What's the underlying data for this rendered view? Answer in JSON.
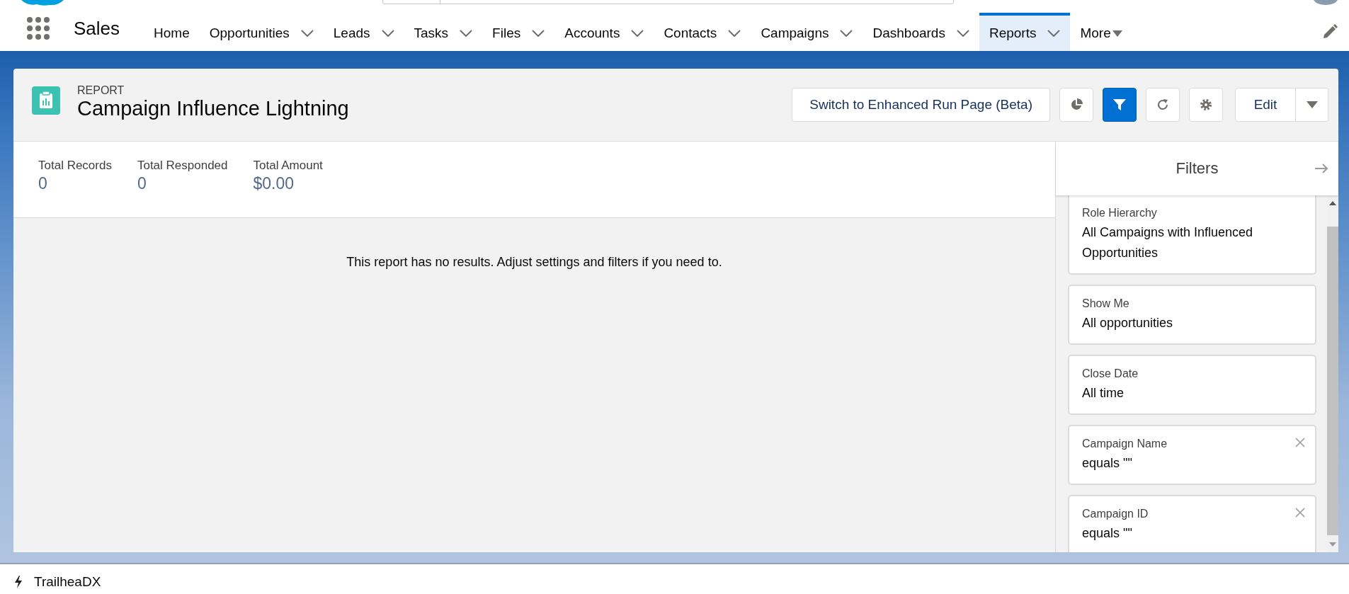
{
  "app_name": "Sales",
  "nav_items": [
    {
      "label": "Home",
      "has_menu": false,
      "selected": false
    },
    {
      "label": "Opportunities",
      "has_menu": true,
      "selected": false
    },
    {
      "label": "Leads",
      "has_menu": true,
      "selected": false
    },
    {
      "label": "Tasks",
      "has_menu": true,
      "selected": false
    },
    {
      "label": "Files",
      "has_menu": true,
      "selected": false
    },
    {
      "label": "Accounts",
      "has_menu": true,
      "selected": false
    },
    {
      "label": "Contacts",
      "has_menu": true,
      "selected": false
    },
    {
      "label": "Campaigns",
      "has_menu": true,
      "selected": false
    },
    {
      "label": "Dashboards",
      "has_menu": true,
      "selected": false
    },
    {
      "label": "Reports",
      "has_menu": true,
      "selected": true
    }
  ],
  "more_menu": {
    "label": "More"
  },
  "report_header": {
    "object_type": "REPORT",
    "title": "Campaign Influence Lightning"
  },
  "actions": {
    "switch_button": "Switch to Enhanced Run Page (Beta)",
    "icon_buttons": [
      {
        "kind": "chart",
        "selected": false
      },
      {
        "kind": "filter",
        "selected": true
      },
      {
        "kind": "refresh",
        "selected": false
      },
      {
        "kind": "settings",
        "selected": false
      }
    ],
    "edit_button": "Edit"
  },
  "stats": [
    {
      "label": "Total Records",
      "value": "0"
    },
    {
      "label": "Total Responded",
      "value": "0"
    },
    {
      "label": "Total Amount",
      "value": "$0.00"
    }
  ],
  "empty_message": "This report has no results. Adjust settings and filters if you need to.",
  "filters_panel": {
    "title": "Filters",
    "items": [
      {
        "label": "Role Hierarchy",
        "value": "All Campaigns with Influenced Opportunities",
        "removable": false
      },
      {
        "label": "Show Me",
        "value": "All opportunities",
        "removable": false
      },
      {
        "label": "Close Date",
        "value": "All time",
        "removable": false
      },
      {
        "label": "Campaign Name",
        "value": "equals \"\"",
        "removable": true
      },
      {
        "label": "Campaign ID",
        "value": "equals \"\"",
        "removable": true
      }
    ]
  },
  "footer": {
    "label": "TrailheaDX"
  }
}
